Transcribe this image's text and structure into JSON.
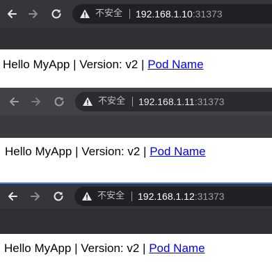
{
  "windows": [
    {
      "security_label": "不安全",
      "host": "192.168.1.10",
      "port": ":31373",
      "greeting": "Hello MyApp | Version: v2 | ",
      "link": "Pod Name"
    },
    {
      "security_label": "不安全",
      "host": "192.168.1.11",
      "port": ":31373",
      "greeting": "Hello MyApp | Version: v2 | ",
      "link": "Pod Name"
    },
    {
      "security_label": "不安全",
      "host": "192.168.1.12",
      "port": ":31373",
      "greeting": "Hello MyApp | Version: v2 | ",
      "link": "Pod Name"
    }
  ],
  "colors": {
    "toolbar": "#35363a",
    "omnibox": "#202124",
    "link": "#0000ee"
  }
}
